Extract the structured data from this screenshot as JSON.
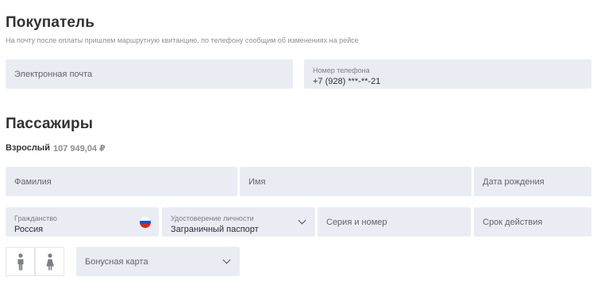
{
  "buyer": {
    "title": "Покупатель",
    "subtitle": "На почту после оплаты пришлем маршрутную квитанцию, по телефону сообщим об изменениях на рейсе",
    "email": {
      "placeholder": "Электронная почта",
      "value": ""
    },
    "phone": {
      "label": "Номер телефона",
      "value": "+7 (928) ***-**-21"
    }
  },
  "passengers": {
    "title": "Пассажиры",
    "type_label": "Взрослый",
    "price": "107 949,04 ₽",
    "fields": {
      "last_name": "Фамилия",
      "first_name": "Имя",
      "birth_date": "Дата рождения",
      "citizenship_label": "Гражданство",
      "citizenship_value": "Россия",
      "document_label": "Удостоверение личности",
      "document_value": "Заграничный паспорт",
      "series_number": "Серия и номер",
      "expiry": "Срок действия",
      "bonus_card": "Бонусная карта"
    },
    "gender_icons": [
      "male-icon",
      "female-icon"
    ],
    "flag_colors": [
      "#ffffff",
      "#1f55c5",
      "#d52b1e"
    ]
  }
}
